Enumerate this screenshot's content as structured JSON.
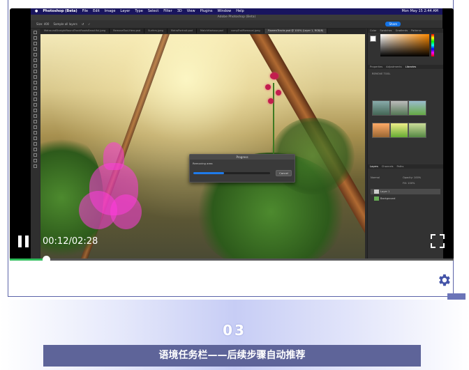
{
  "menubar": {
    "apple": "",
    "app": "Photoshop (Beta)",
    "items": [
      "File",
      "Edit",
      "Image",
      "Layer",
      "Type",
      "Select",
      "Filter",
      "3D",
      "View",
      "Plugins",
      "Window",
      "Help"
    ],
    "clock": "Mon May 15  2:44 AM"
  },
  "window": {
    "title": "Adobe Photoshop (Beta)"
  },
  "options": {
    "size": "Size: 400",
    "sample": "Sample all layers",
    "share": "Share"
  },
  "tabs": [
    "MetroundStraightRoundTrackRoadsBeautiful.jpeg",
    "RemoveTool-Hero.psd",
    "Surfers.jpeg",
    "MetroPortrait.psd",
    "MatchHarbour.psd",
    "compTrailRemoval.jpeg",
    "FlowersTracks.psd @ 100% (Layer 1, RGB/8)"
  ],
  "right_panel": {
    "top_tabs": [
      "Color",
      "Swatches",
      "Gradients",
      "Patterns"
    ],
    "mid_tabs": [
      "Properties",
      "Adjustments",
      "Libraries"
    ],
    "library_name": "REMOVE TOOL",
    "layer_tabs": [
      "Layers",
      "Channels",
      "Paths"
    ],
    "blend": "Normal",
    "opacity": "Opacity: 100%",
    "fill": "Fill: 100%",
    "layers": [
      "Layer 1",
      "Background"
    ]
  },
  "dialog": {
    "title": "Progress",
    "message": "Removing area",
    "cancel": "Cancel",
    "progress": 0.4
  },
  "player": {
    "time": "00:12/02:28",
    "progress": 0.082
  },
  "section": {
    "number": "03",
    "title": "语境任务栏——后续步骤自动推荐"
  }
}
